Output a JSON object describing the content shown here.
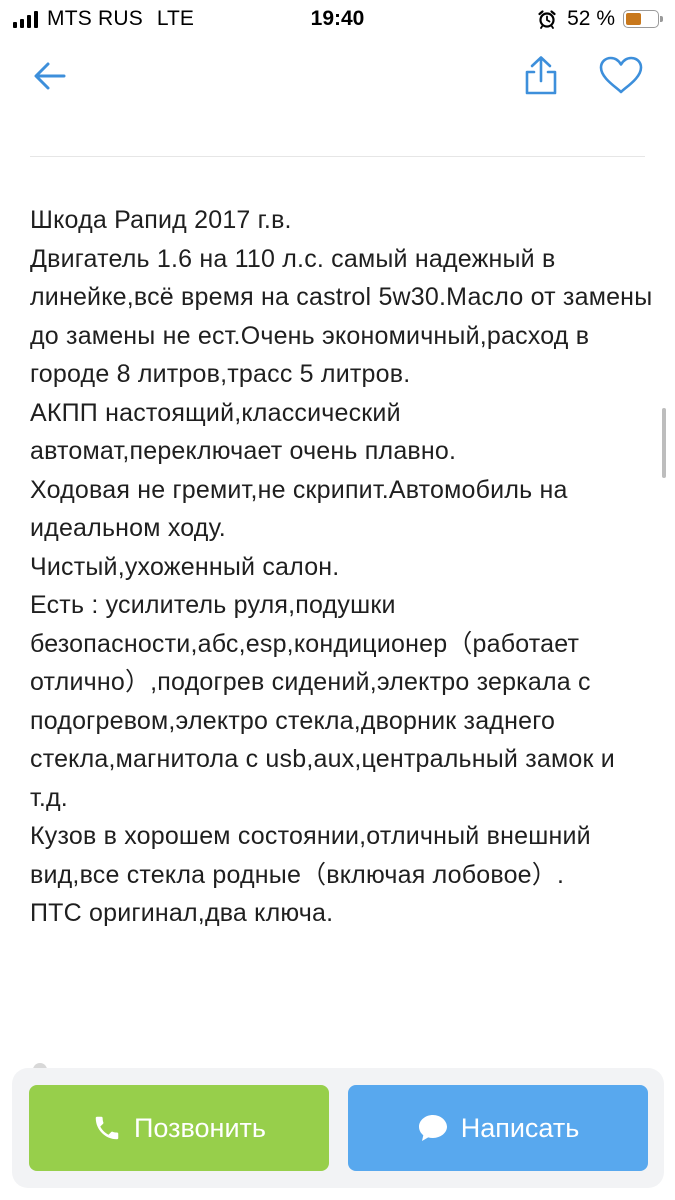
{
  "status_bar": {
    "carrier": "MTS RUS",
    "network": "LTE",
    "time": "19:40",
    "battery_percent": "52 %",
    "battery_level": 0.52,
    "icons": [
      "signal-icon",
      "alarm-icon",
      "battery-icon"
    ]
  },
  "nav": {
    "icons": [
      "back-arrow-icon",
      "share-icon",
      "heart-icon"
    ]
  },
  "listing": {
    "description": "Шкода Рапид 2017 г.в.\nДвигатель 1.6 на 110 л.с. самый надежный в линейке,всё время на castrol 5w30.Масло от замены до замены не ест.Очень экономичный,расход в городе 8 литров,трасс 5 литров.\nАКПП настоящий,классический автомат,переключает очень плавно.\nХодовая не гремит,не скрипит.Автомобиль на идеальном ходу.\nЧистый,ухоженный салон.\nЕсть : усилитель руля,подушки безопасности,абс,esp,кондиционер（работает отлично）,подогрев сидений,электро зеркала с подогревом,электро стекла,дворник заднего стекла,магнитола с usb,aux,центральный замок и т.д.\nКузов в хорошем состоянии,отличный внешний вид,все стекла родные（включая лобовое）.\nПТС оригинал,два ключа."
  },
  "actions": {
    "call_label": "Позвонить",
    "message_label": "Написать",
    "call_color": "#97cf4b",
    "message_color": "#58a8ee",
    "icons": [
      "phone-icon",
      "chat-bubble-icon"
    ]
  },
  "theme": {
    "accent": "#3d8fdb"
  }
}
